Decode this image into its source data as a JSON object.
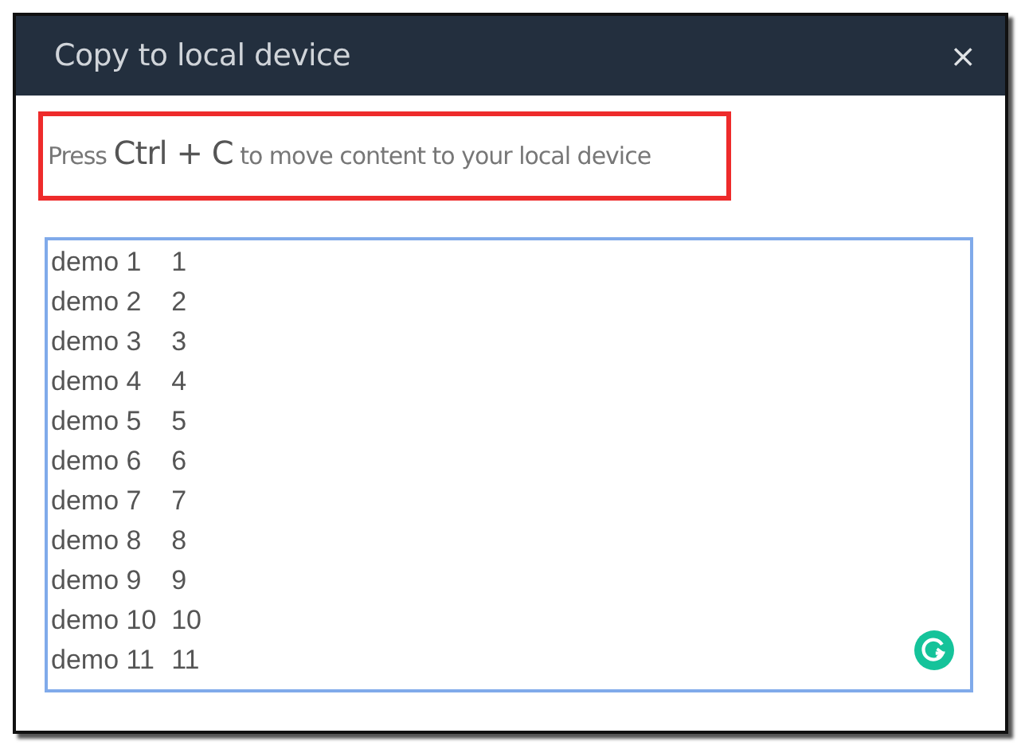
{
  "dialog": {
    "title": "Copy to local device",
    "close": "×"
  },
  "instruction": {
    "before": "Press",
    "keys": "Ctrl + C",
    "after": "to move content to your local device"
  },
  "content": {
    "lines": [
      "demo 1\t1",
      "demo 2\t2",
      "demo 3\t3",
      "demo 4\t4",
      "demo 5\t5",
      "demo 6\t6",
      "demo 7\t7",
      "demo 8\t8",
      "demo 9\t9",
      "demo 10\t10",
      "demo 11\t11"
    ]
  }
}
